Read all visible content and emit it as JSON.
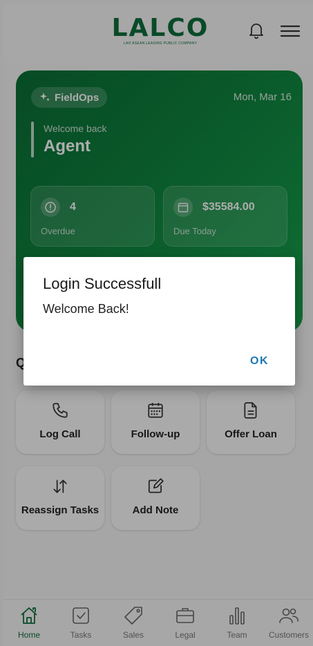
{
  "header": {
    "logo_text": "LALCO",
    "logo_subtitle": "LAO ASEAN LEASING PUBLIC COMPANY",
    "icons": {
      "notifications": "bell-icon",
      "menu": "hamburger-menu-icon"
    }
  },
  "hero": {
    "chip_label": "FieldOps",
    "date": "Mon, Mar 16",
    "welcome_label": "Welcome back",
    "user_name": "Agent",
    "stats": [
      {
        "value": "4",
        "label": "Overdue",
        "icon": "clock-alert-icon"
      },
      {
        "value": "$35584.00",
        "label": "Due Today",
        "icon": "calendar-icon"
      }
    ]
  },
  "quick_actions": {
    "title": "Q",
    "items": [
      {
        "label": "Log Call",
        "icon": "phone-icon"
      },
      {
        "label": "Follow-up",
        "icon": "calendar-grid-icon"
      },
      {
        "label": "Offer Loan",
        "icon": "document-icon"
      },
      {
        "label": "Reassign Tasks",
        "icon": "swap-arrows-icon"
      },
      {
        "label": "Add Note",
        "icon": "edit-note-icon"
      }
    ]
  },
  "bottom_nav": {
    "items": [
      {
        "label": "Home",
        "icon": "home-icon",
        "active": true
      },
      {
        "label": "Tasks",
        "icon": "checkbox-icon"
      },
      {
        "label": "Sales",
        "icon": "tag-icon"
      },
      {
        "label": "Legal",
        "icon": "briefcase-icon"
      },
      {
        "label": "Team",
        "icon": "bar-chart-icon"
      },
      {
        "label": "Customers",
        "icon": "users-icon"
      }
    ]
  },
  "dialog": {
    "title": "Login Successfull",
    "message": "Welcome Back!",
    "ok_label": "OK"
  },
  "colors": {
    "brand_green": "#0f6e3b",
    "dialog_button": "#1f77b4"
  }
}
